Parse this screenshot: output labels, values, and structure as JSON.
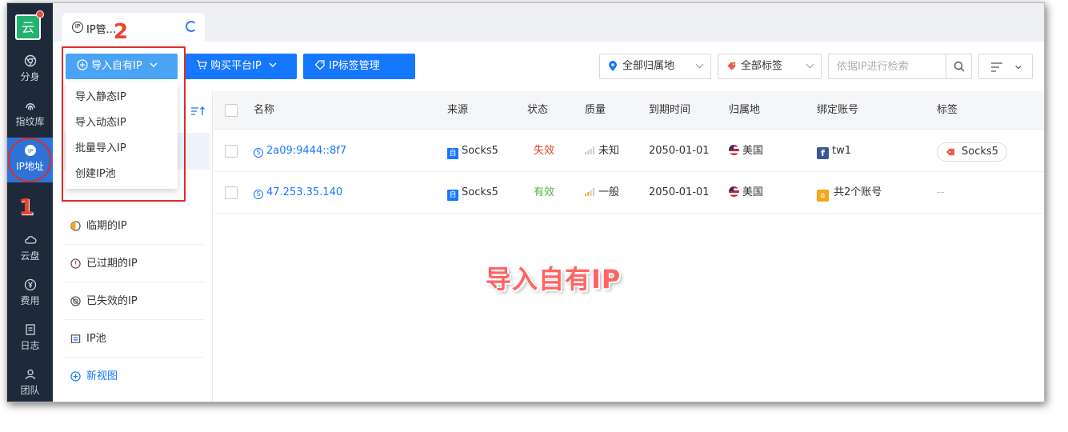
{
  "rail": {
    "logo": "云",
    "items": [
      {
        "label": "分身",
        "icon": "chrome-icon"
      },
      {
        "label": "指纹库",
        "icon": "fingerprint-icon"
      },
      {
        "label": "IP地址",
        "icon": "ip-icon"
      },
      {
        "label": "云盘",
        "icon": "cloud-icon"
      },
      {
        "label": "费用",
        "icon": "yen-icon"
      },
      {
        "label": "日志",
        "icon": "document-icon"
      },
      {
        "label": "团队",
        "icon": "team-icon"
      }
    ],
    "annotation_1": "1"
  },
  "tab": {
    "label": "IP管...",
    "annotation_2": "2"
  },
  "toolbar": {
    "import_label": "导入自有IP",
    "buy_label": "购买平台IP",
    "tag_label": "IP标签管理",
    "location_select": "全部归属地",
    "tag_select": "全部标签",
    "search_placeholder": "依据IP进行检索"
  },
  "dropdown": {
    "items": [
      "导入静态IP",
      "导入动态IP",
      "批量导入IP",
      "创建IP池"
    ]
  },
  "panel": {
    "items": [
      {
        "label": "临期的IP",
        "icon": "clock-icon"
      },
      {
        "label": "已过期的IP",
        "icon": "alert-icon"
      },
      {
        "label": "已失效的IP",
        "icon": "disabled-icon"
      },
      {
        "label": "IP池",
        "icon": "pool-icon"
      },
      {
        "label": "新视图",
        "icon": "plus-circle-icon"
      }
    ]
  },
  "table": {
    "columns": [
      "名称",
      "来源",
      "状态",
      "质量",
      "到期时间",
      "归属地",
      "绑定账号",
      "标签"
    ],
    "rows": [
      {
        "name": "2a09:9444::8f7",
        "source": "Socks5",
        "status": "失效",
        "quality": "未知",
        "expiry": "2050-01-01",
        "location": "美国",
        "account": "tw1",
        "tag": "Socks5"
      },
      {
        "name": "47.253.35.140",
        "source": "Socks5",
        "status": "有效",
        "quality": "一般",
        "expiry": "2050-01-01",
        "location": "美国",
        "account": "共2个账号",
        "tag": "--"
      }
    ]
  },
  "overlay_text": "导入自有IP",
  "colors": {
    "accent": "#1677ff",
    "rail": "#1e2a3a",
    "annotation": "#e02a2a",
    "failed": "#e8432e",
    "valid": "#52b043"
  }
}
